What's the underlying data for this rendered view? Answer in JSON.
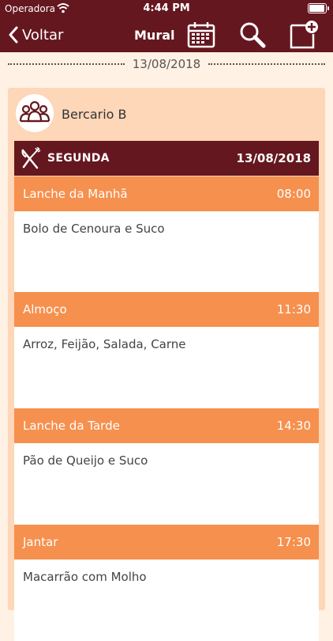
{
  "status_bar": {
    "carrier": "Operadora",
    "time": "4:44 PM"
  },
  "nav": {
    "back_label": "Voltar",
    "title": "Mural",
    "icons": [
      "calendar-icon",
      "search-icon",
      "add-note-icon"
    ]
  },
  "date_divider": "13/08/2018",
  "group": {
    "name": "Bercario B"
  },
  "day": {
    "label": "SEGUNDA",
    "date": "13/08/2018"
  },
  "meals": [
    {
      "name": "Lanche da Manhã",
      "time": "08:00",
      "description": "Bolo de Cenoura e Suco"
    },
    {
      "name": "Almoço",
      "time": "11:30",
      "description": "Arroz, Feijão, Salada, Carne"
    },
    {
      "name": "Lanche da Tarde",
      "time": "14:30",
      "description": "Pão de Queijo e Suco"
    },
    {
      "name": "Jantar",
      "time": "17:30",
      "description": "Macarrão com Molho"
    }
  ],
  "colors": {
    "primary": "#65171f",
    "accent": "#f6904e",
    "card_background": "#fed6b8",
    "page_background": "#fff1e4"
  }
}
